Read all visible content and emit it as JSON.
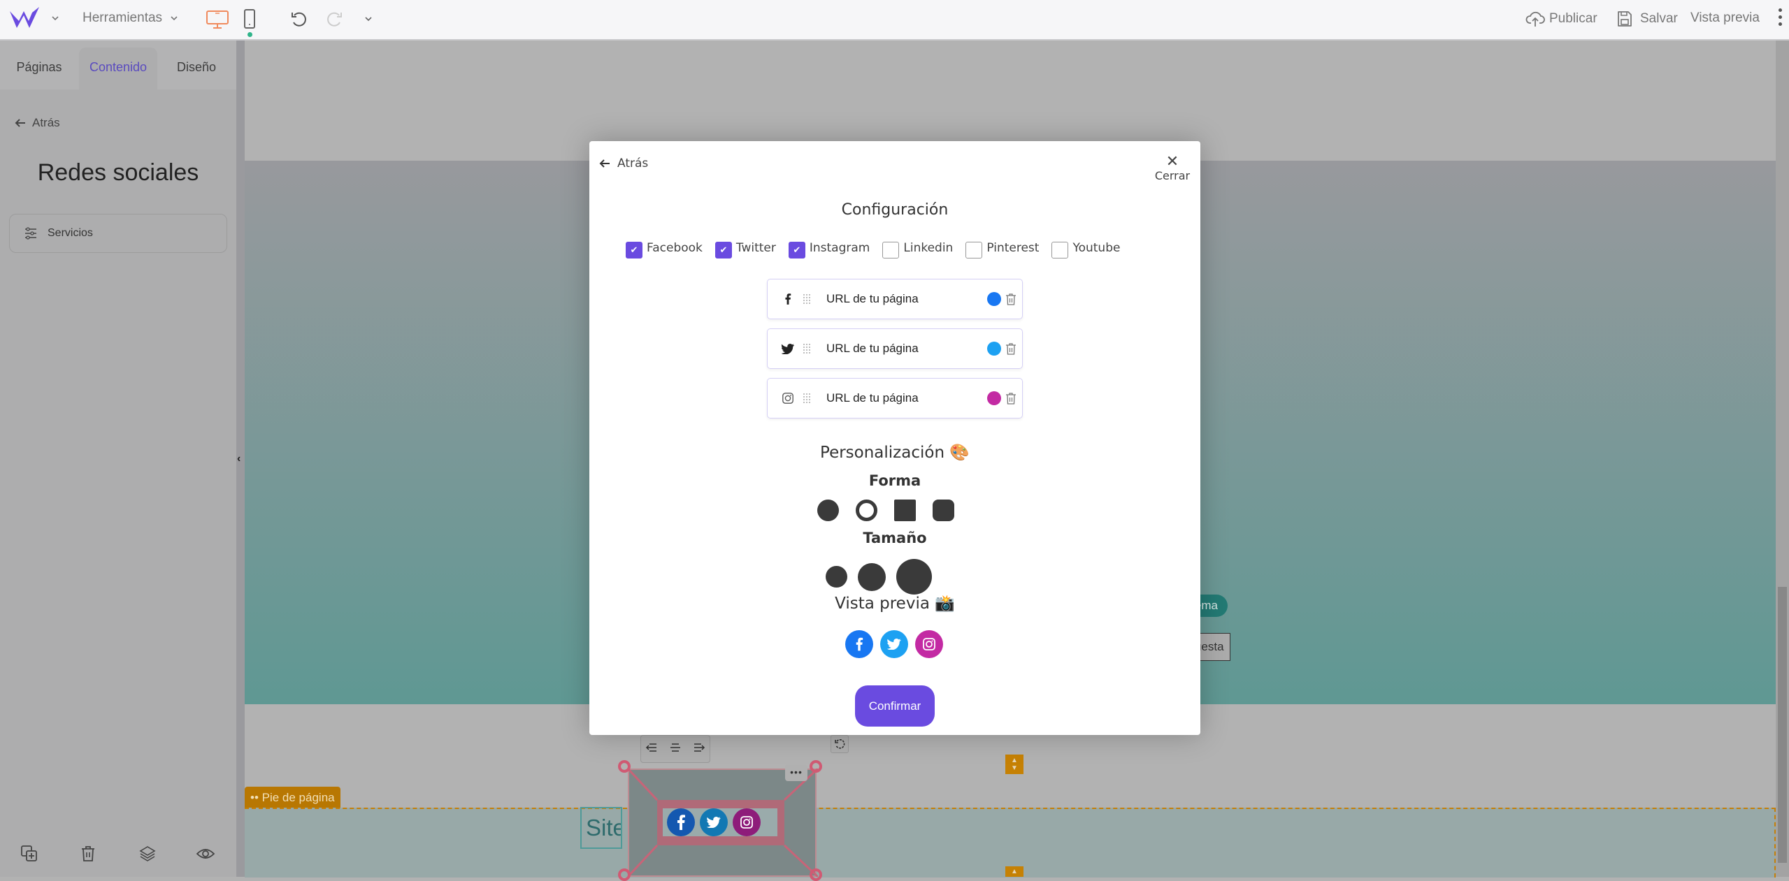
{
  "topbar": {
    "logo": "W",
    "tools_label": "Herramientas",
    "publish_label": "Publicar",
    "save_label": "Salvar",
    "preview_label": "Vista previa",
    "accent_color": "#6a4be0",
    "device_active_color": "#f08a5d"
  },
  "left_panel": {
    "tabs": [
      {
        "label": "Páginas",
        "active": false
      },
      {
        "label": "Contenido",
        "active": true
      },
      {
        "label": "Diseño",
        "active": false
      }
    ],
    "back_label": "Atrás",
    "title": "Redes sociales",
    "services_label": "Servicios"
  },
  "canvas": {
    "hero_pill_text": "o tema",
    "hero_button_text": "spuesta",
    "footer_tag": "•• Pie de página",
    "site_text": "SiteW"
  },
  "modal": {
    "back_label": "Atrás",
    "close_label": "Cerrar",
    "config_title": "Configuración",
    "networks": [
      {
        "label": "Facebook",
        "checked": true
      },
      {
        "label": "Twitter",
        "checked": true
      },
      {
        "label": "Instagram",
        "checked": true
      },
      {
        "label": "Linkedin",
        "checked": false
      },
      {
        "label": "Pinterest",
        "checked": false
      },
      {
        "label": "Youtube",
        "checked": false
      }
    ],
    "url_rows": [
      {
        "network": "facebook",
        "placeholder": "URL de tu página",
        "value": "URL de tu página",
        "color": "#1877f2"
      },
      {
        "network": "twitter",
        "placeholder": "URL de tu página",
        "value": "URL de tu página",
        "color": "#1da1f2"
      },
      {
        "network": "instagram",
        "placeholder": "URL de tu página",
        "value": "URL de tu página",
        "color": "#c32aa3"
      }
    ],
    "personalization_title": "Personalización 🎨",
    "shape_title": "Forma",
    "shapes": [
      "circle-filled",
      "circle-outline",
      "square",
      "rounded-square"
    ],
    "size_title": "Tamaño",
    "sizes": [
      "small",
      "medium",
      "large"
    ],
    "preview_title": "Vista previa 📸",
    "confirm_label": "Confirmar"
  }
}
